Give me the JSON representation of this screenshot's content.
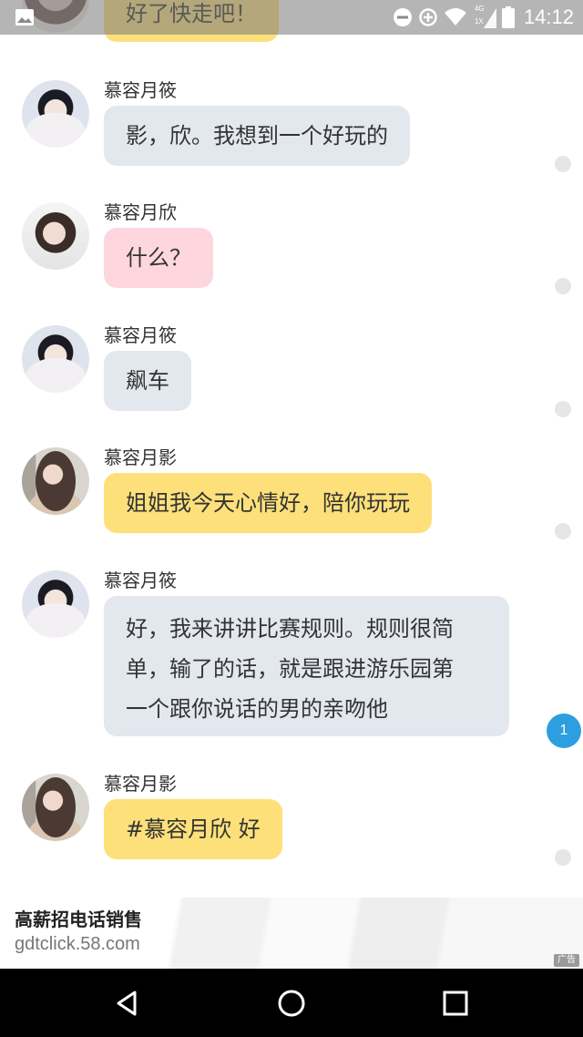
{
  "status_bar": {
    "time": "14:12",
    "network_label": "4G",
    "network_sublabel": "1X",
    "icons": [
      "gallery-icon",
      "dnd-icon",
      "data-saver-icon",
      "wifi-icon",
      "signal-icon",
      "battery-icon"
    ]
  },
  "partial_message": {
    "text": "好了快走吧！"
  },
  "messages": [
    {
      "sender": "慕容月筱",
      "text": "影，欣。我想到一个好玩的",
      "color": "gray"
    },
    {
      "sender": "慕容月欣",
      "text": "什么？",
      "color": "pink"
    },
    {
      "sender": "慕容月筱",
      "text": "飙车",
      "color": "gray"
    },
    {
      "sender": "慕容月影",
      "text": "姐姐我今天心情好，陪你玩玩",
      "color": "yellow"
    },
    {
      "sender": "慕容月筱",
      "lines": [
        "好，我来讲讲比赛规则。规则很简",
        "单，输了的话，就是跟进游乐园第",
        "一个跟你说话的男的亲吻他"
      ],
      "color": "gray",
      "badge": "1"
    },
    {
      "sender": "慕容月影",
      "text": "#慕容月欣 好",
      "color": "yellow"
    }
  ],
  "ad": {
    "title": "高薪招电话销售",
    "url": "gdtclick.58.com",
    "tag": "广告"
  },
  "colors": {
    "gray_bubble": "#e3e7ee",
    "pink_bubble": "#fdd7dd",
    "yellow_bubble": "#fde07a",
    "badge": "#2d9fe0"
  },
  "nav_bar": {
    "buttons": [
      "back-icon",
      "home-icon",
      "recents-icon"
    ]
  }
}
